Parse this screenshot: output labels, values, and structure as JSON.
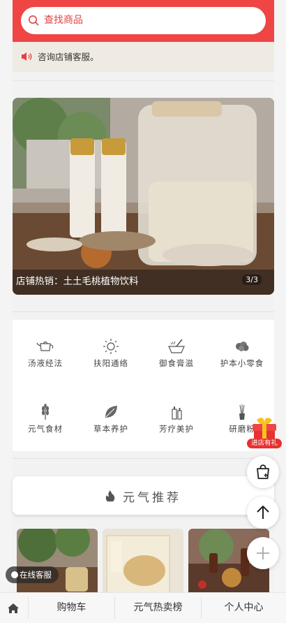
{
  "search": {
    "placeholder": "查找商品"
  },
  "notice": {
    "text": "咨询店铺客服。"
  },
  "banner": {
    "caption": "店铺热销：土土毛桃植物饮料",
    "pager": "3/3"
  },
  "categories": [
    {
      "label": "汤液经法",
      "icon": "teapot-icon"
    },
    {
      "label": "扶阳通络",
      "icon": "sun-icon"
    },
    {
      "label": "御食膏滋",
      "icon": "mortar-icon"
    },
    {
      "label": "护本小零食",
      "icon": "snack-icon"
    },
    {
      "label": "元气食材",
      "icon": "wheat-icon"
    },
    {
      "label": "草本养护",
      "icon": "leaf-icon"
    },
    {
      "label": "芳疗美护",
      "icon": "bottles-icon"
    },
    {
      "label": "研磨粉",
      "icon": "diffuser-icon"
    }
  ],
  "recommend": {
    "title": "元气推荐"
  },
  "float": {
    "gift_label": "进店有礼"
  },
  "chat": {
    "label": "在线客服"
  },
  "tabbar": {
    "cart": "购物车",
    "hot": "元气热卖榜",
    "me": "个人中心"
  },
  "colors": {
    "accent": "#f04545",
    "notice_bg": "#efebe2"
  }
}
